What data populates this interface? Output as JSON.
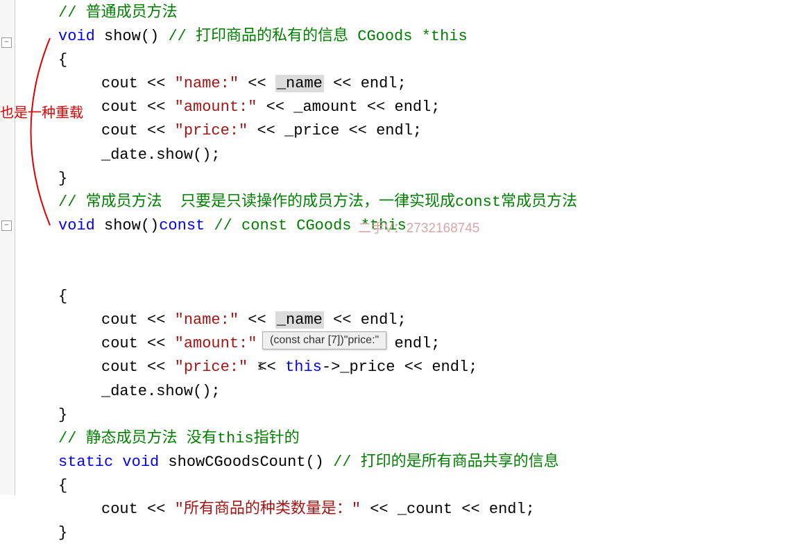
{
  "comments": {
    "normal_method": "// 普通成员方法",
    "show_comment": "// 打印商品的私有的信息 CGoods *this",
    "const_method": "// 常成员方法  只要是只读操作的成员方法，一律实现成const常成员方法",
    "show_const_comment": "// const CGoods *this",
    "static_method_prefix": "// 静态成员方法 没有",
    "static_method_this": "this",
    "static_method_suffix": "指针的",
    "show_count_comment": "// 打印的是所有商品共享的信息"
  },
  "code": {
    "void": "void",
    "const": "const",
    "static": "static",
    "this": "this",
    "show_sig": " show() ",
    "show_const_sig": " show()",
    "showCount_sig": " showCGoodsCount() ",
    "brace_open": "{",
    "brace_close": "}",
    "cout": "cout",
    "op": " << ",
    "endl": "endl;",
    "name_var": "_name",
    "amount_var": "_amount",
    "price_var": "_price",
    "count_var": "_count",
    "this_price": "->_price",
    "date_show": "_date.show();",
    "str_name": "\"name:\"",
    "str_amount": "\"amount:\"",
    "str_price": "\"price:\"",
    "str_count": "\"所有商品的种类数量是：\""
  },
  "annotation": "也是一种重载",
  "watermark": "二手V：2732168745",
  "tooltip": "(const char [7])\"price:\"",
  "fold_markers": [
    "−",
    "−"
  ]
}
